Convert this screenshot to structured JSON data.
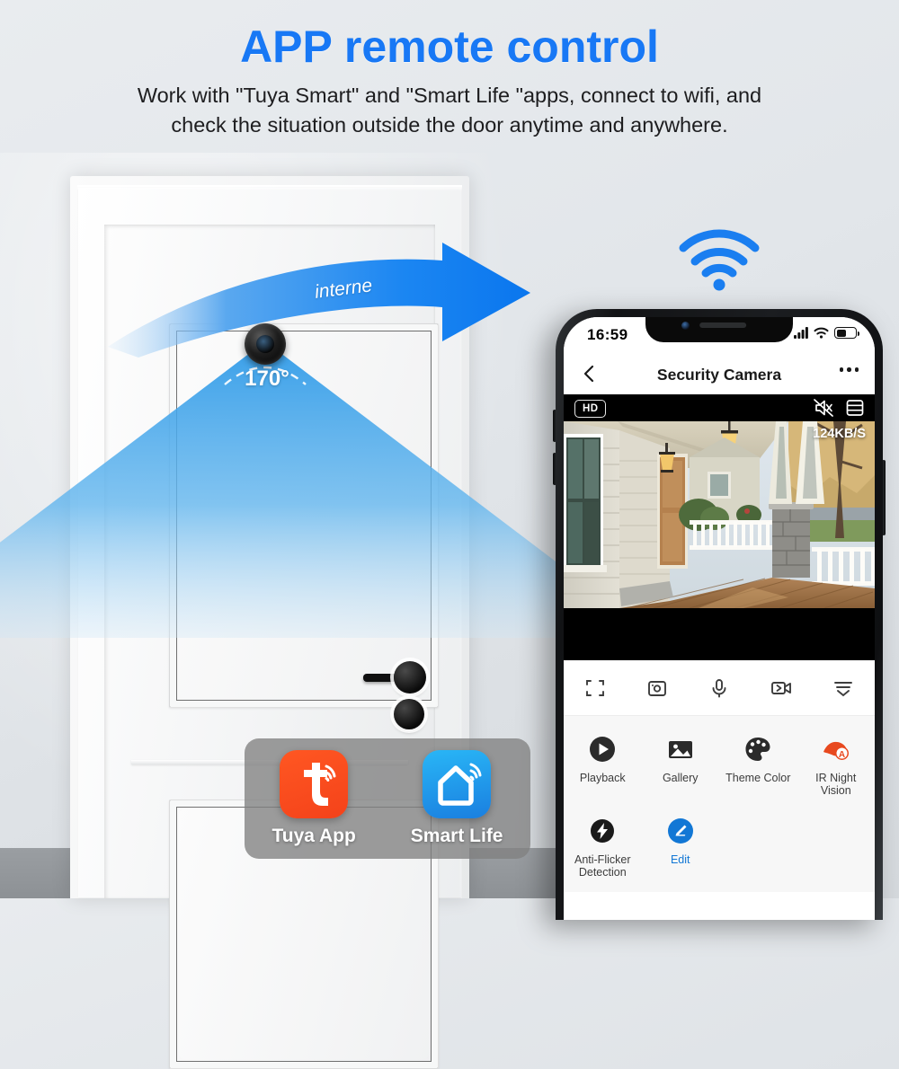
{
  "header": {
    "title": "APP remote control",
    "subtitle_line1": "Work with \"Tuya Smart\" and \"Smart Life \"apps, connect to wifi, and",
    "subtitle_line2": "check the situation outside the door anytime and anywhere.",
    "title_color": "#1878f5"
  },
  "scene": {
    "fov_angle": "170°",
    "internet_label": "interne",
    "wifi_icon": "wifi-icon",
    "camera_icon": "camera-lens-icon",
    "arrow_icon": "curved-arrow-icon",
    "accent_blue": "#1e90ff"
  },
  "phone": {
    "status_bar": {
      "time": "16:59",
      "signal_icon": "signal-bars-icon",
      "wifi_icon": "wifi-status-icon",
      "battery_icon": "battery-icon",
      "battery_level": 45
    },
    "nav": {
      "back_icon": "chevron-left-icon",
      "title": "Security Camera",
      "more_icon": "ellipsis-icon"
    },
    "video": {
      "quality_badge": "HD",
      "mute_icon": "speaker-mute-icon",
      "layout_icon": "split-view-icon",
      "bitrate": "124KB/S"
    },
    "controls": [
      {
        "name": "fullscreen-icon",
        "icon": "fullscreen"
      },
      {
        "name": "screenshot-icon",
        "icon": "screenshot"
      },
      {
        "name": "microphone-icon",
        "icon": "microphone"
      },
      {
        "name": "record-icon",
        "icon": "record"
      },
      {
        "name": "collapse-icon",
        "icon": "collapse"
      }
    ],
    "features_row1": [
      {
        "label": "Playback",
        "icon": "playback-icon",
        "color": "#2b2b2b"
      },
      {
        "label": "Gallery",
        "icon": "gallery-icon",
        "color": "#2b2b2b"
      },
      {
        "label": "Theme Color",
        "icon": "palette-icon",
        "color": "#2b2b2b"
      },
      {
        "label": "IR Night Vision",
        "icon": "night-vision-icon",
        "color": "#e8491f"
      }
    ],
    "features_row2": [
      {
        "label": "Anti-Flicker Detection",
        "icon": "flash-icon",
        "color": "#1a1a1a"
      },
      {
        "label": "Edit",
        "icon": "edit-pencil-icon",
        "color": "#1277d5"
      }
    ]
  },
  "apps": [
    {
      "name": "Tuya App",
      "icon": "tuya-logo-icon",
      "color": "#ff5722"
    },
    {
      "name": "Smart Life",
      "icon": "smartlife-house-icon",
      "color": "#1a8fe3"
    }
  ]
}
